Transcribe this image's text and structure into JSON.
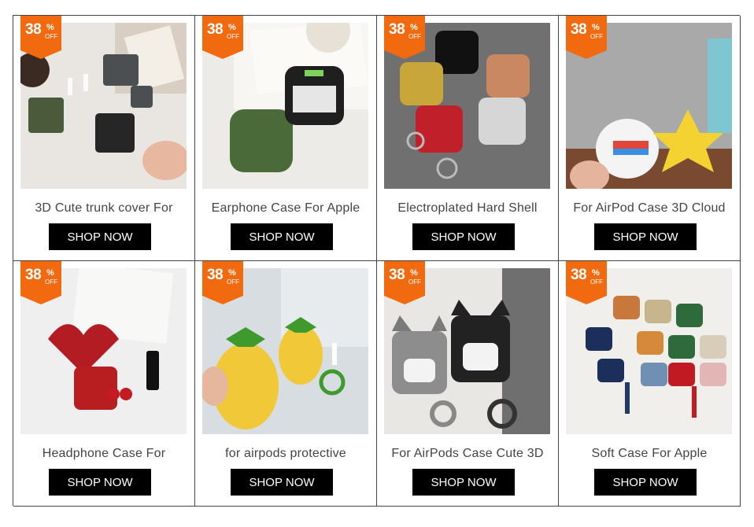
{
  "promo": {
    "discount_number": "38",
    "discount_percent": "%",
    "discount_off": "OFF",
    "badge_color": "#f26a10"
  },
  "button_color": "#000000",
  "products": [
    {
      "title": "3D Cute trunk cover For",
      "cta": "SHOP NOW"
    },
    {
      "title": "Earphone Case For Apple",
      "cta": "SHOP NOW"
    },
    {
      "title": "Electroplated Hard Shell",
      "cta": "SHOP NOW"
    },
    {
      "title": "For AirPod Case 3D Cloud",
      "cta": "SHOP NOW"
    },
    {
      "title": "Headphone Case For",
      "cta": "SHOP NOW"
    },
    {
      "title": "for airpods protective",
      "cta": "SHOP NOW"
    },
    {
      "title": "For AirPods Case Cute 3D",
      "cta": "SHOP NOW"
    },
    {
      "title": "Soft Case For Apple",
      "cta": "SHOP NOW"
    }
  ]
}
